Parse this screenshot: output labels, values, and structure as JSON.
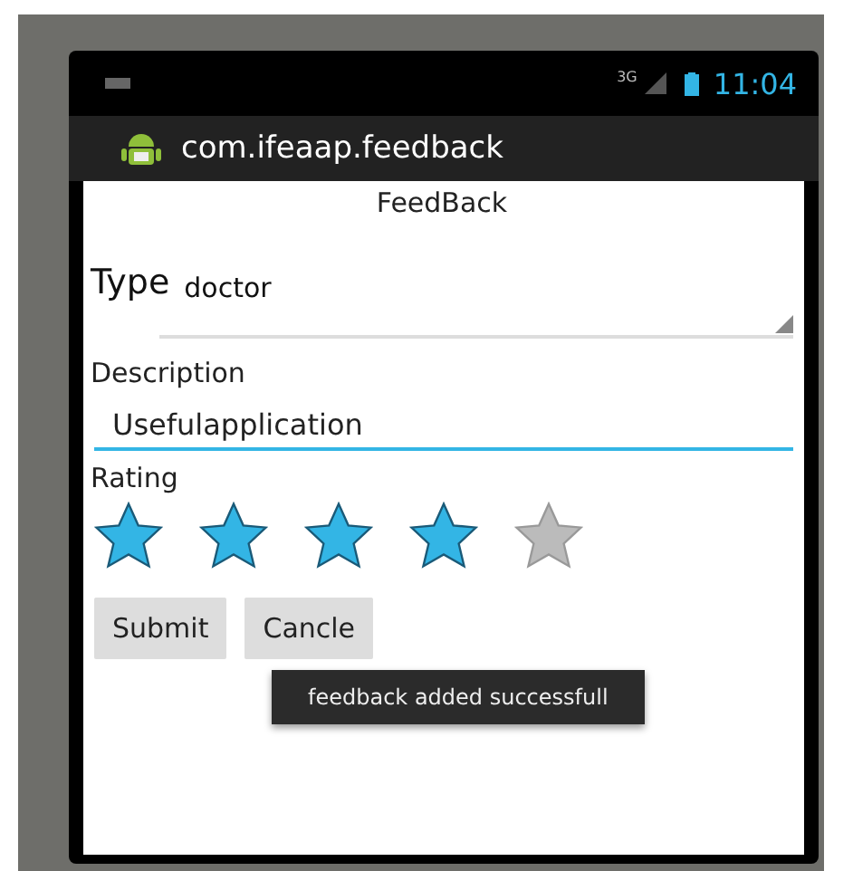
{
  "status_bar": {
    "network": "3G",
    "time": "11:04"
  },
  "action_bar": {
    "title": "com.ifeaap.feedback"
  },
  "form": {
    "heading": "FeedBack",
    "type_label": "Type",
    "type_value": "doctor",
    "description_label": "Description",
    "description_value": "Usefulapplication",
    "rating_label": "Rating",
    "rating": {
      "stars": 4
    }
  },
  "buttons": [
    "Submit",
    "Cancle"
  ],
  "toast": "feedback added successfull"
}
